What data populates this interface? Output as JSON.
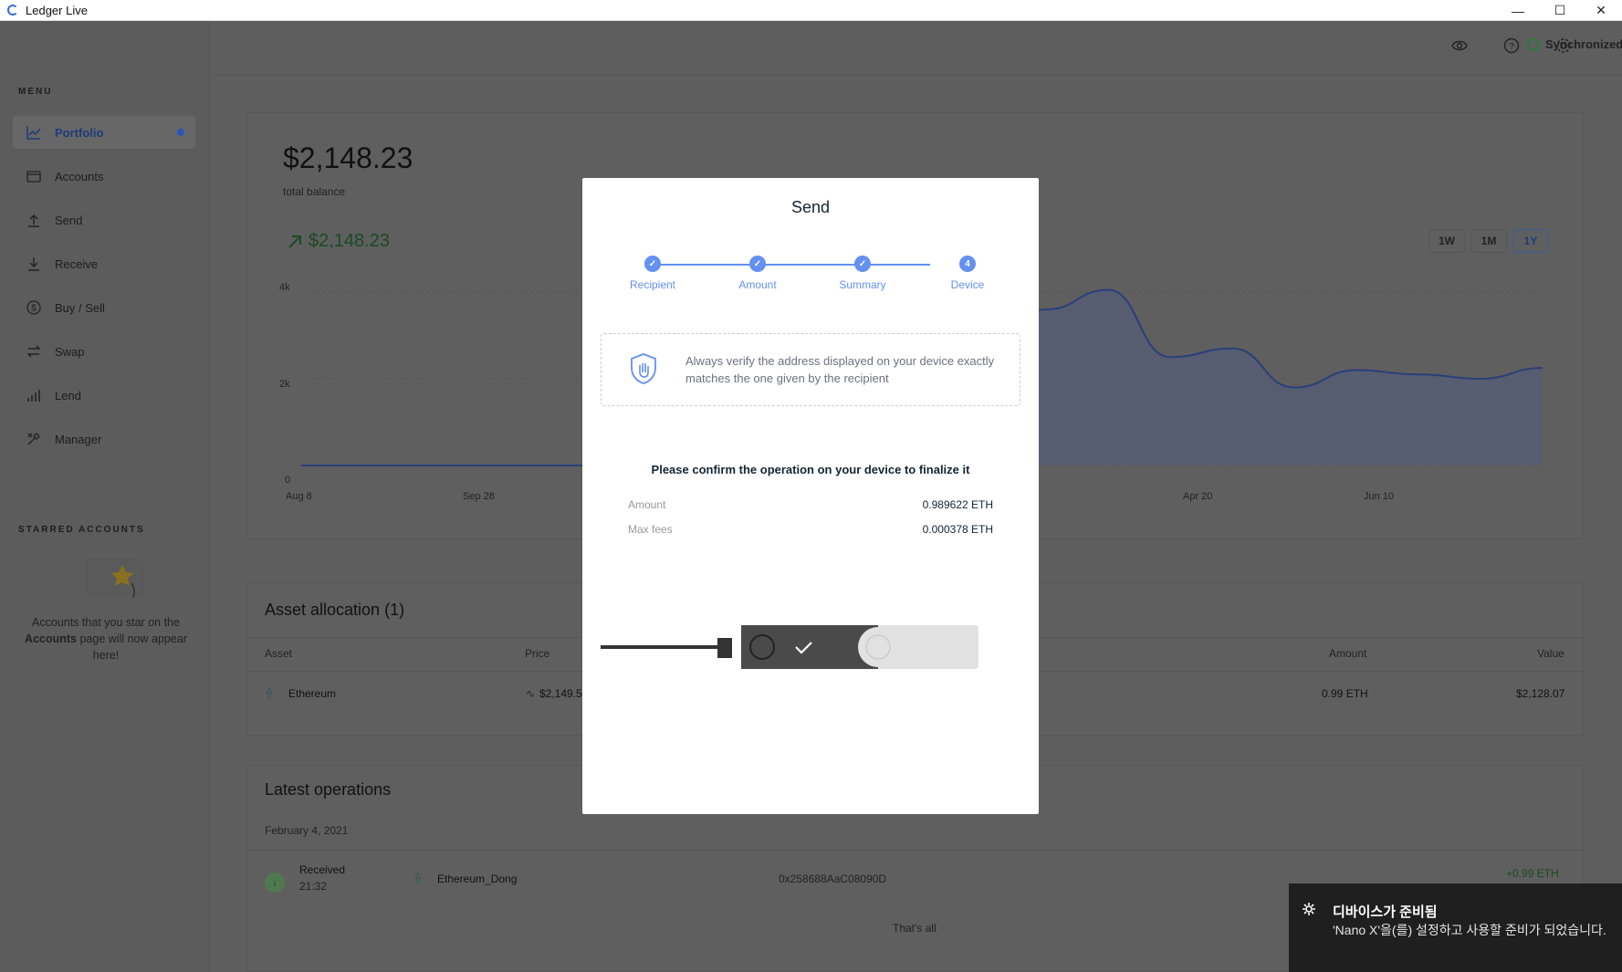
{
  "window": {
    "title": "Ledger Live",
    "minimize": "—",
    "maximize": "☐",
    "close": "✕"
  },
  "sidebar": {
    "menu_label": "MENU",
    "items": [
      {
        "label": "Portfolio",
        "icon": "chart-icon"
      },
      {
        "label": "Accounts",
        "icon": "wallet-icon"
      },
      {
        "label": "Send",
        "icon": "upload-icon"
      },
      {
        "label": "Receive",
        "icon": "download-icon"
      },
      {
        "label": "Buy / Sell",
        "icon": "dollar-icon"
      },
      {
        "label": "Swap",
        "icon": "swap-icon"
      },
      {
        "label": "Lend",
        "icon": "lend-icon"
      },
      {
        "label": "Manager",
        "icon": "tools-icon"
      }
    ],
    "starred_label": "STARRED ACCOUNTS",
    "starred_text_1": "Accounts that you star on the",
    "starred_text_bold": "Accounts",
    "starred_text_2": "page will now appear here!"
  },
  "topbar": {
    "sync_label": "Synchronized"
  },
  "portfolio": {
    "balance": "$2,148.23",
    "balance_label": "total balance",
    "gain": "$2,148.23",
    "ranges": [
      "1W",
      "1M",
      "1Y"
    ],
    "active_range": "1Y",
    "y_ticks": [
      "4k",
      "2k",
      "0"
    ],
    "x_ticks": [
      "Aug 8",
      "Sep 28",
      "Apr 20",
      "Jun 10"
    ]
  },
  "chart_data": {
    "type": "area",
    "x": [
      "Aug 8",
      "Sep 28",
      "Apr 20",
      "Jun 10"
    ],
    "y_ticks": [
      "0",
      "2k",
      "4k"
    ],
    "series": [
      {
        "values": [
          0,
          0,
          0,
          0,
          0,
          0,
          1700,
          1750,
          1850,
          2200,
          2150,
          2600,
          3600,
          4050,
          2500,
          2700,
          1800,
          2200,
          2100,
          2000,
          2250
        ]
      }
    ]
  },
  "asset_allocation": {
    "title": "Asset allocation (1)",
    "headers": [
      "Asset",
      "Price",
      "Amount",
      "Value"
    ],
    "rows": [
      {
        "asset": "Ethereum",
        "price": "$2,149.5",
        "amount": "0.99 ETH",
        "value": "$2,128.07"
      }
    ]
  },
  "latest_operations": {
    "title": "Latest operations",
    "date": "February 4, 2021",
    "op_type": "Received",
    "op_time": "21:32",
    "op_account": "Ethereum_Dong",
    "op_address": "0x258688AaC08090D",
    "op_amount": "+0.99 ETH",
    "footer": "That's all"
  },
  "modal": {
    "title": "Send",
    "steps": [
      "Recipient",
      "Amount",
      "Summary",
      "Device"
    ],
    "step_4_number": "4",
    "warning": "Always verify the address displayed on your device exactly matches the one given by the recipient",
    "confirm": "Please confirm the operation on your device to finalize it",
    "amount_label": "Amount",
    "amount_value": "0.989622 ETH",
    "fees_label": "Max fees",
    "fees_value": "0.000378 ETH"
  },
  "toast": {
    "title": "디바이스가 준비됨",
    "body": "'Nano X'을(를) 설정하고 사용할 준비가 되었습니다."
  }
}
